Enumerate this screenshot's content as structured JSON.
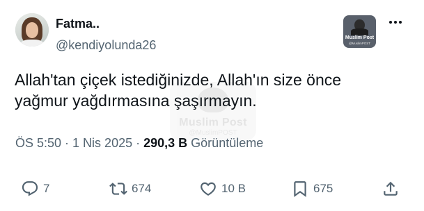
{
  "author": {
    "name": "Fatma..",
    "handle": "@kendiyolunda26"
  },
  "badge": {
    "title": "Muslim Post",
    "handle": "@MuslimPOST"
  },
  "watermark": {
    "title": "Muslim Post",
    "handle": "@MuslimPOST"
  },
  "tweet": {
    "line1": "Allah'tan çiçek istediğinizde, Allah'ın size önce",
    "line2": "yağmur yağdırmasına şaşırmayın."
  },
  "meta": {
    "time": "ÖS 5:50",
    "separator": "·",
    "date": "1 Nis 2025",
    "views_count": "290,3 B",
    "views_label": "Görüntüleme"
  },
  "actions": {
    "replies": "7",
    "retweets": "674",
    "likes": "10 B",
    "bookmarks": "675"
  },
  "colors": {
    "text": "#0f1419",
    "secondary": "#536471",
    "background": "#ffffff"
  },
  "icons": [
    "more-icon",
    "reply-icon",
    "retweet-icon",
    "like-icon",
    "bookmark-icon",
    "share-icon"
  ]
}
